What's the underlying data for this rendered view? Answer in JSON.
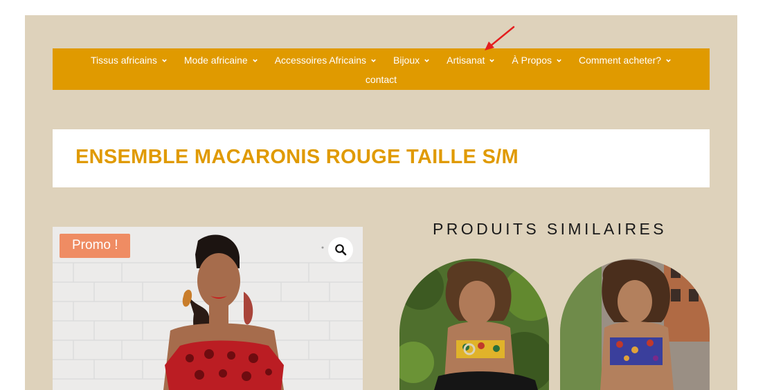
{
  "nav": {
    "row1": [
      "Tissus africains",
      "Mode africaine",
      "Accessoires Africains",
      "Bijoux",
      "Artisanat",
      "À Propos",
      "Comment acheter?"
    ],
    "row2": [
      "contact"
    ]
  },
  "icons": {
    "dropdown": "chevron-down-icon",
    "zoom": "magnifier-icon",
    "annotation": "red-arrow-icon"
  },
  "product": {
    "title": "ENSEMBLE MACARONIS ROUGE TAILLE S/M",
    "badge": "Promo !"
  },
  "related": {
    "heading": "PRODUITS SIMILAIRES"
  },
  "colors": {
    "accent": "#e09a00",
    "page_background": "#ded2bb",
    "promo_badge": "#ef8c63",
    "annotation_arrow": "#e41e1e"
  }
}
